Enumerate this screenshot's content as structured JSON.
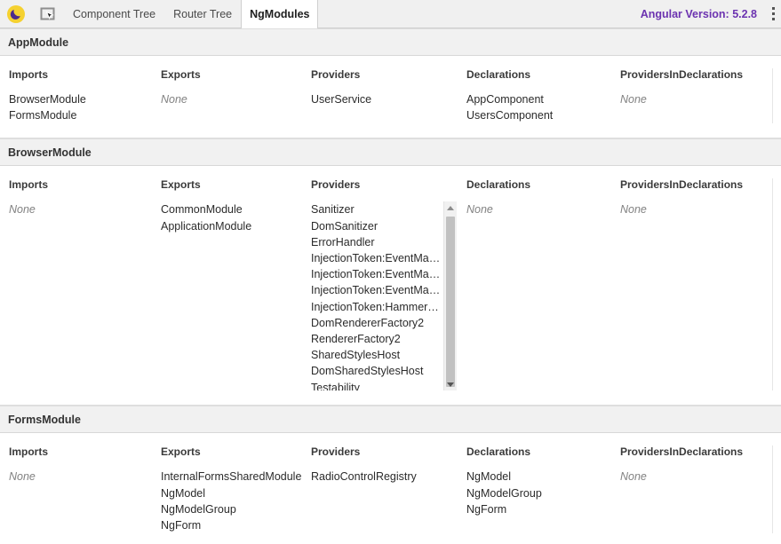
{
  "toolbar": {
    "logo_icon": "angular-augury-moon-logo",
    "inspect_icon": "element-select-cursor-icon",
    "tabs": [
      {
        "label": "Component Tree",
        "active": false
      },
      {
        "label": "Router Tree",
        "active": false
      },
      {
        "label": "NgModules",
        "active": true
      }
    ],
    "version_label": "Angular Version: 5.2.8",
    "version_color": "#6c33b0",
    "menu_icon": "kebab-menu-icon"
  },
  "columns": [
    "Imports",
    "Exports",
    "Providers",
    "Declarations",
    "ProvidersInDeclarations"
  ],
  "none_label": "None",
  "modules": [
    {
      "name": "AppModule",
      "imports": [
        "BrowserModule",
        "FormsModule"
      ],
      "exports": [],
      "providers": [
        "UserService"
      ],
      "declarations": [
        "AppComponent",
        "UsersComponent"
      ],
      "providers_in_declarations": []
    },
    {
      "name": "BrowserModule",
      "imports": [],
      "exports": [
        "CommonModule",
        "ApplicationModule"
      ],
      "providers": [
        "Sanitizer",
        "DomSanitizer",
        "ErrorHandler",
        "InjectionToken:EventMa…",
        "InjectionToken:EventMa…",
        "InjectionToken:EventMa…",
        "InjectionToken:Hammer…",
        "DomRendererFactory2",
        "RendererFactory2",
        "SharedStylesHost",
        "DomSharedStylesHost",
        "Testability"
      ],
      "providers_scrollable": true,
      "declarations": [],
      "providers_in_declarations": []
    },
    {
      "name": "FormsModule",
      "imports": [],
      "exports": [
        "InternalFormsSharedModule",
        "NgModel",
        "NgModelGroup",
        "NgForm"
      ],
      "providers": [
        "RadioControlRegistry"
      ],
      "declarations": [
        "NgModel",
        "NgModelGroup",
        "NgForm"
      ],
      "providers_in_declarations": []
    }
  ]
}
